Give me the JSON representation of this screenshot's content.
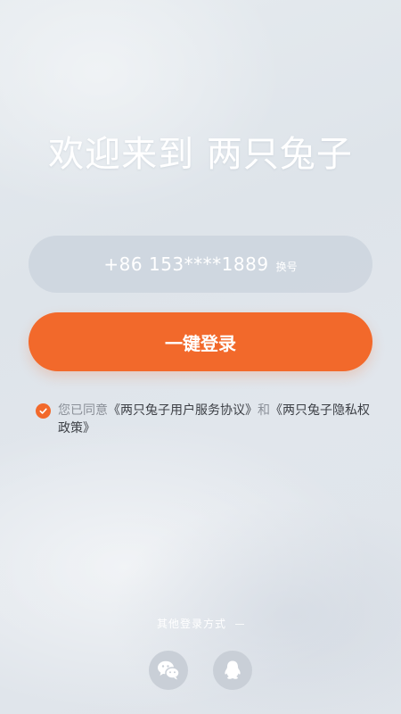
{
  "welcome": {
    "title": "欢迎来到 两只兔子"
  },
  "login": {
    "phone_number": "+86 153****1889",
    "switch_label": "换号",
    "login_button_label": "一键登录"
  },
  "agreement": {
    "checked": true,
    "prefix": "您已同意",
    "terms_link": "《两只兔子用户服务协议》",
    "conjunction": "和",
    "privacy_link": "《两只兔子隐私权政策》"
  },
  "other_login": {
    "title": "其他登录方式",
    "methods": [
      {
        "icon": "wechat-icon"
      },
      {
        "icon": "qq-icon"
      }
    ]
  },
  "colors": {
    "accent": "#f2692b",
    "background": "#e2e7ed",
    "field": "#cdd5de",
    "link_text": "#3d4046",
    "muted_text": "#8b9098"
  }
}
